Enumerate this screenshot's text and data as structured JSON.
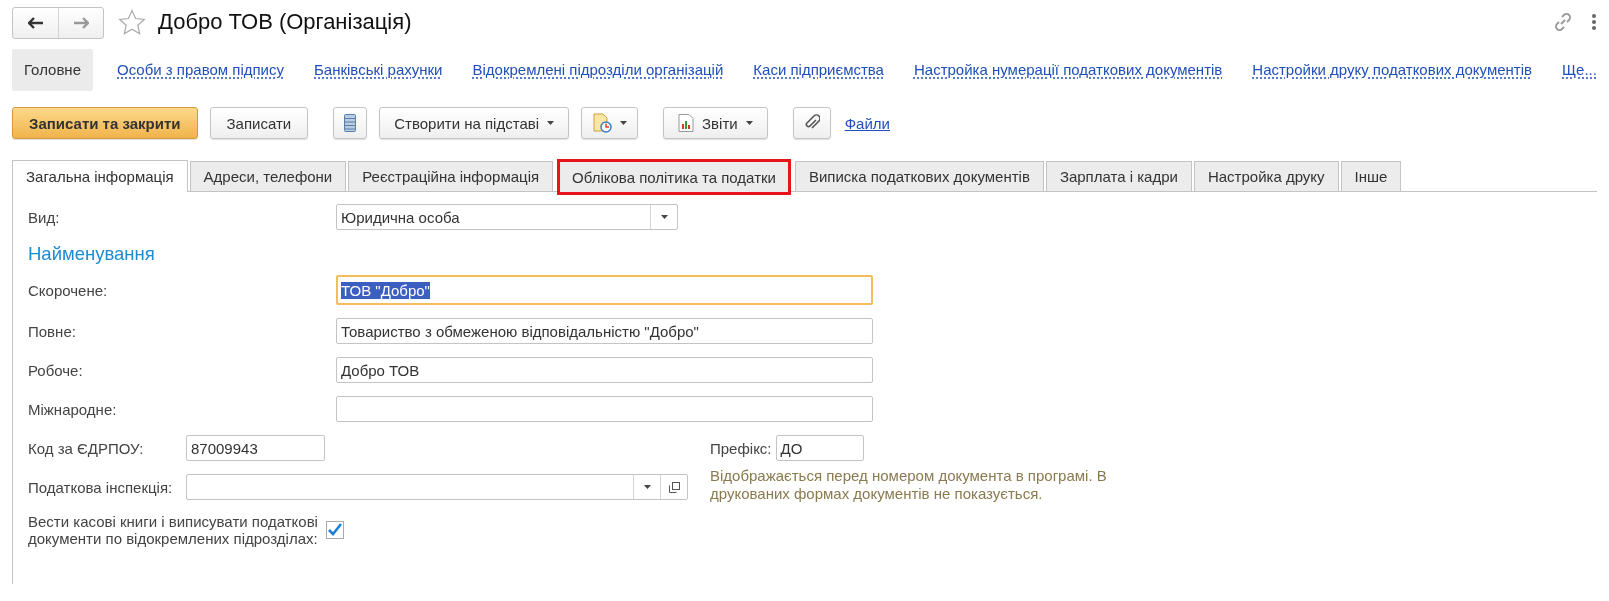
{
  "window": {
    "title": "Добро ТОВ (Організація)",
    "favorite": false
  },
  "nav": [
    {
      "label": "Головне",
      "selected": true
    },
    {
      "label": "Особи з правом підпису",
      "selected": false
    },
    {
      "label": "Банківські рахунки",
      "selected": false
    },
    {
      "label": "Відокремлені підрозділи організацій",
      "selected": false
    },
    {
      "label": "Каси підприємства",
      "selected": false
    },
    {
      "label": "Настройка нумерації податкових документів",
      "selected": false
    },
    {
      "label": "Настройки друку податкових документів",
      "selected": false
    },
    {
      "label": "Ще...",
      "selected": false
    }
  ],
  "toolbar": [
    {
      "kind": "primary",
      "label": "Записати та закрити"
    },
    {
      "kind": "button",
      "label": "Записати"
    },
    {
      "kind": "list"
    },
    {
      "kind": "menu",
      "label": "Створити на підставі"
    },
    {
      "kind": "document-menu"
    },
    {
      "kind": "report-menu",
      "label": "Звіти"
    },
    {
      "kind": "attach"
    },
    {
      "kind": "link",
      "label": "Файли"
    }
  ],
  "tabs": [
    {
      "label": "Загальна інформація",
      "selected": true,
      "highlighted": false
    },
    {
      "label": "Адреси, телефони",
      "selected": false,
      "highlighted": false
    },
    {
      "label": "Реєстраційна інформація",
      "selected": false,
      "highlighted": false
    },
    {
      "label": "Облікова політика та податки",
      "selected": false,
      "highlighted": true
    },
    {
      "label": "Виписка податкових документів",
      "selected": false,
      "highlighted": false
    },
    {
      "label": "Зарплата і кадри",
      "selected": false,
      "highlighted": false
    },
    {
      "label": "Настройка друку",
      "selected": false,
      "highlighted": false
    },
    {
      "label": "Інше",
      "selected": false,
      "highlighted": false
    }
  ],
  "form": {
    "type_field": {
      "label": "Вид:",
      "value": "Юридична особа"
    },
    "section": "Найменування",
    "names": [
      {
        "label": "Скорочене:",
        "value": "ТОВ \"Добро\"",
        "focused": true
      },
      {
        "label": "Повне:",
        "value": "Товариство з обмеженою відповідальністю \"Добро\"",
        "focused": false
      },
      {
        "label": "Робоче:",
        "value": "Добро ТОВ",
        "focused": false
      },
      {
        "label": "Міжнародне:",
        "focused": false
      }
    ],
    "edrpou": {
      "label": "Код за ЄДРПОУ:",
      "value": "87009943"
    },
    "prefix": {
      "label": "Префікс:",
      "value": "ДО",
      "hint": "Відображається перед номером документа в програмі. В друкованих формах документів не показується."
    },
    "tax_inspection": {
      "label": "Податкова інспекція:"
    },
    "separate_books": {
      "label": "Вести касові книги і виписувати податкові документи по відокремлених підрозділах:",
      "checked": true
    }
  }
}
